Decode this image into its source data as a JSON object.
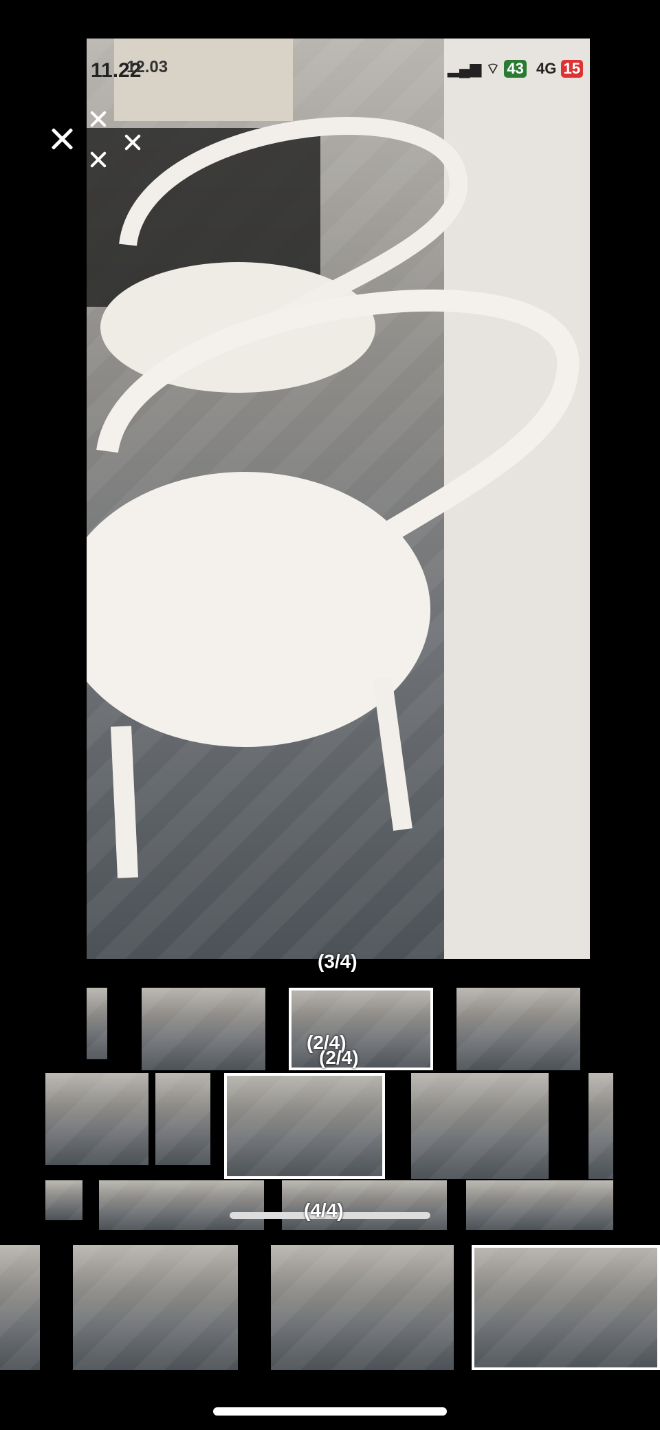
{
  "status_bar": {
    "time": "11.22",
    "time_overlap": "12.03",
    "network": "4G",
    "mail_badge": "43",
    "battery": "15"
  },
  "viewer": {
    "counter_main": "(3/4)",
    "counter_strip_a": "(2/4)",
    "counter_strip_b": "(2/4)",
    "counter_strip_c": "(4/4)"
  },
  "icons": {
    "close": "close-icon",
    "signal": "signal-icon",
    "wifi": "wifi-icon",
    "battery": "battery-icon"
  }
}
